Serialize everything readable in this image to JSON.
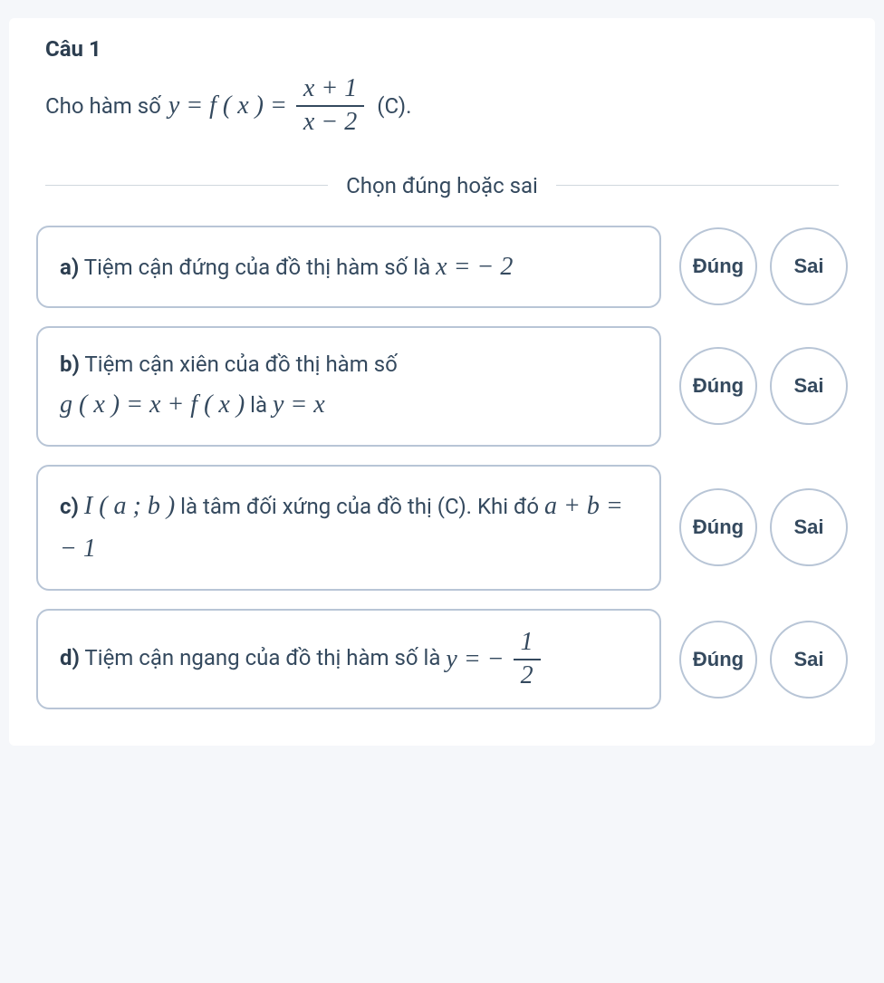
{
  "question": {
    "title": "Câu 1",
    "prompt_prefix": "Cho hàm số",
    "prompt_suffix": "(C).",
    "math_lhs": "y = f ( x ) =",
    "frac_num": "x + 1",
    "frac_den": "x − 2"
  },
  "divider": "Chọn đúng hoặc sai",
  "options": [
    {
      "label": "a)",
      "text_before": "Tiệm cận đứng của đồ thị hàm số là",
      "math": "x = − 2",
      "text_after": ""
    },
    {
      "label": "b)",
      "text_before": "Tiệm cận xiên của đồ thị hàm số",
      "math": "g ( x ) = x + f ( x )",
      "text_mid": "là",
      "math2": "y = x",
      "text_after": ""
    },
    {
      "label": "c)",
      "math_before": "I ( a ; b )",
      "text_before": "là tâm đối xứng của đồ thị (C). Khi đó",
      "math": "a + b = − 1",
      "text_after": ""
    },
    {
      "label": "d)",
      "text_before": "Tiệm cận ngang của đồ thị hàm số là",
      "math_lhs": "y = −",
      "frac_num": "1",
      "frac_den": "2",
      "text_after": ""
    }
  ],
  "buttons": {
    "true": "Đúng",
    "false": "Sai"
  }
}
